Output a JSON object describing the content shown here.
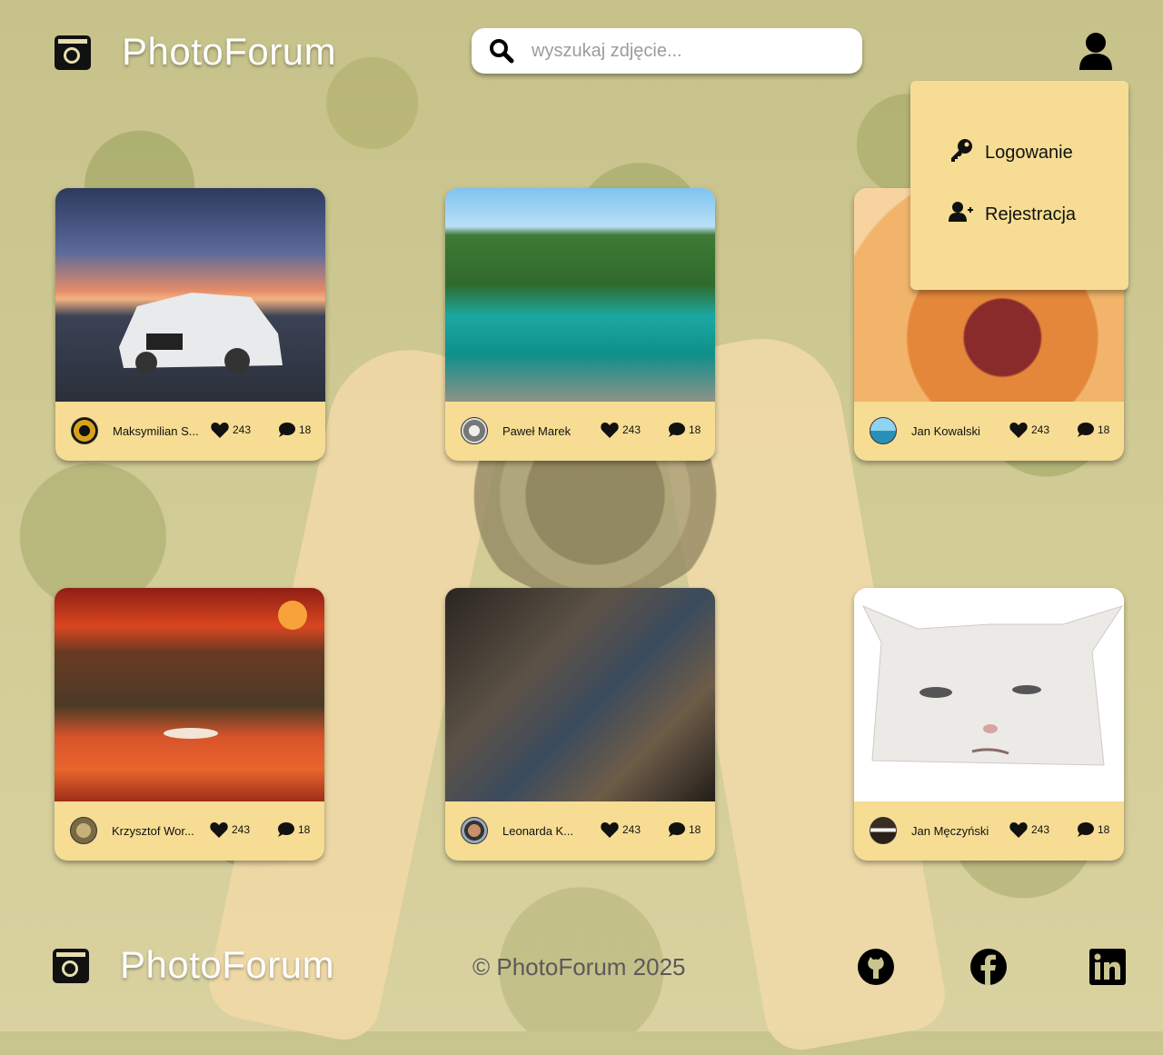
{
  "app": {
    "name": "PhotoForum"
  },
  "search": {
    "placeholder": "wyszukaj zdjęcie..."
  },
  "user_menu": {
    "items": [
      {
        "label": "Logowanie",
        "icon": "key-icon"
      },
      {
        "label": "Rejestracja",
        "icon": "user-plus-icon"
      }
    ]
  },
  "posts": [
    {
      "author": "Maksymilian S...",
      "likes": "243",
      "comments": "18",
      "photo": "sports-car"
    },
    {
      "author": "Paweł Marek",
      "likes": "243",
      "comments": "18",
      "photo": "lake-valley"
    },
    {
      "author": "Jan Kowalski",
      "likes": "243",
      "comments": "18",
      "photo": "dog"
    },
    {
      "author": "Krzysztof Wor...",
      "likes": "243",
      "comments": "18",
      "photo": "sunset-swans"
    },
    {
      "author": "Leonarda K...",
      "likes": "243",
      "comments": "18",
      "photo": "attic"
    },
    {
      "author": "Jan Męczyński",
      "likes": "243",
      "comments": "18",
      "photo": "white-cat"
    }
  ],
  "footer": {
    "copyright": "© PhotoForum 2025"
  },
  "colors": {
    "card": "#f6dd93",
    "accent": "#111111"
  }
}
